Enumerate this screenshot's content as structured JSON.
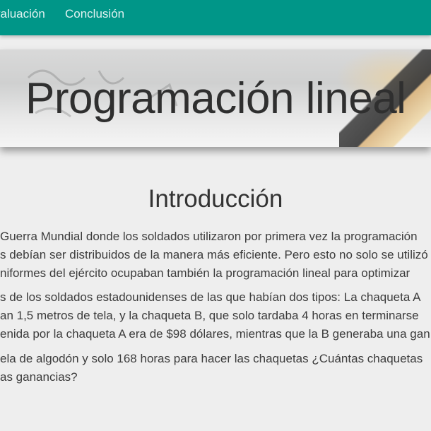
{
  "nav": {
    "items": [
      {
        "label": "valuación"
      },
      {
        "label": "Conclusión"
      }
    ]
  },
  "hero": {
    "title": "Programación lineal"
  },
  "section": {
    "title": "Introducción",
    "paragraphs": [
      {
        "lines": [
          "Guerra Mundial donde los soldados utilizaron por primera vez la programación",
          "s debían ser distribuidos de la manera más eficiente. Pero esto no solo se utilizó",
          "niformes del ejército ocupaban también la programación lineal para optimizar"
        ]
      },
      {
        "lines": [
          "s de los soldados estadounidenses de las que habían dos tipos: La chaqueta A",
          "an 1,5 metros de tela, y la chaqueta B, que solo tardaba 4 horas en terminarse",
          "enida por la chaqueta A era de $98 dólares, mientras que la B generaba una gan"
        ]
      },
      {
        "lines": [
          "ela de algodón y solo 168 horas para hacer las chaquetas ¿Cuántas chaquetas",
          "as ganancias?"
        ]
      }
    ]
  },
  "colors": {
    "nav_bg": "#009688",
    "page_bg": "#eeeeee",
    "text": "#3c3c3c"
  }
}
